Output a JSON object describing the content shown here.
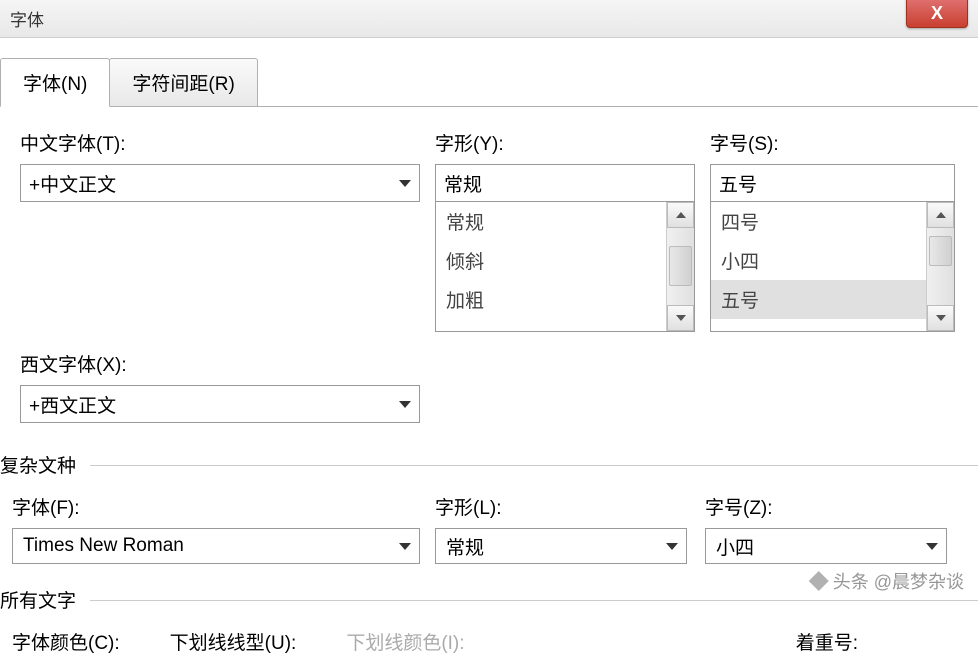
{
  "window": {
    "title": "字体"
  },
  "tabs": {
    "font": "字体(N)",
    "spacing": "字符间距(R)"
  },
  "chineseFont": {
    "label": "中文字体(T):",
    "value": "+中文正文"
  },
  "westernFont": {
    "label": "西文字体(X):",
    "value": "+西文正文"
  },
  "fontStyle": {
    "label": "字形(Y):",
    "value": "常规",
    "items": [
      "常规",
      "倾斜",
      "加粗"
    ]
  },
  "fontSize": {
    "label": "字号(S):",
    "value": "五号",
    "items": [
      "四号",
      "小四",
      "五号"
    ]
  },
  "complexScript": {
    "title": "复杂文种",
    "font": {
      "label": "字体(F):",
      "value": "Times New Roman"
    },
    "style": {
      "label": "字形(L):",
      "value": "常规"
    },
    "size": {
      "label": "字号(Z):",
      "value": "小四"
    }
  },
  "allText": {
    "title": "所有文字",
    "color": "字体颜色(C):",
    "underlineStyle": "下划线线型(U):",
    "underlineColor": "下划线颜色(I):",
    "emphasis": "着重号:"
  },
  "watermark": "头条 @晨梦杂谈"
}
